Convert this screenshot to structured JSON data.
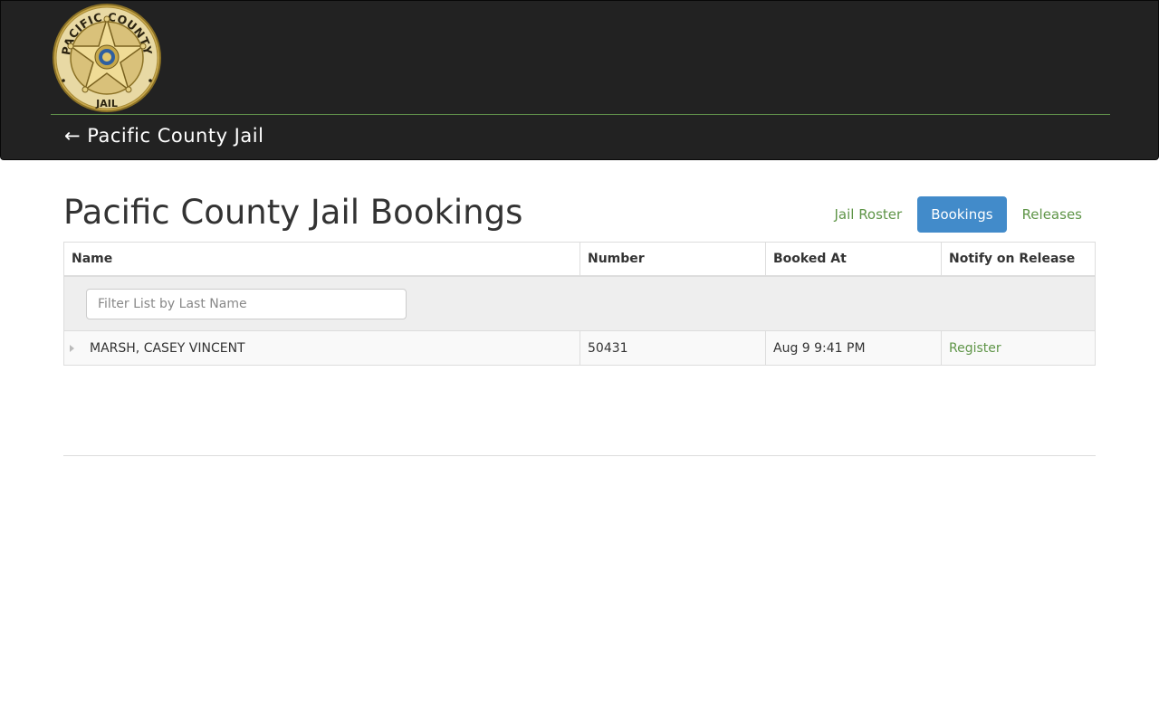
{
  "header": {
    "logo_text_top": "PACIFIC COUNTY",
    "logo_text_bottom": "JAIL",
    "back_arrow": "←",
    "back_label": "Pacific County Jail"
  },
  "page": {
    "title": "Pacific County Jail Bookings"
  },
  "nav": {
    "items": [
      {
        "label": "Jail Roster",
        "active": false
      },
      {
        "label": "Bookings",
        "active": true
      },
      {
        "label": "Releases",
        "active": false
      }
    ]
  },
  "table": {
    "columns": [
      "Name",
      "Number",
      "Booked At",
      "Notify on Release"
    ],
    "filter_placeholder": "Filter List by Last Name",
    "rows": [
      {
        "name": "MARSH, CASEY VINCENT",
        "number": "50431",
        "booked_at": "Aug 9 9:41 PM",
        "notify": "Register"
      }
    ]
  },
  "colors": {
    "header_bg": "#222222",
    "accent_green": "#5f9548",
    "active_pill": "#428bca"
  }
}
